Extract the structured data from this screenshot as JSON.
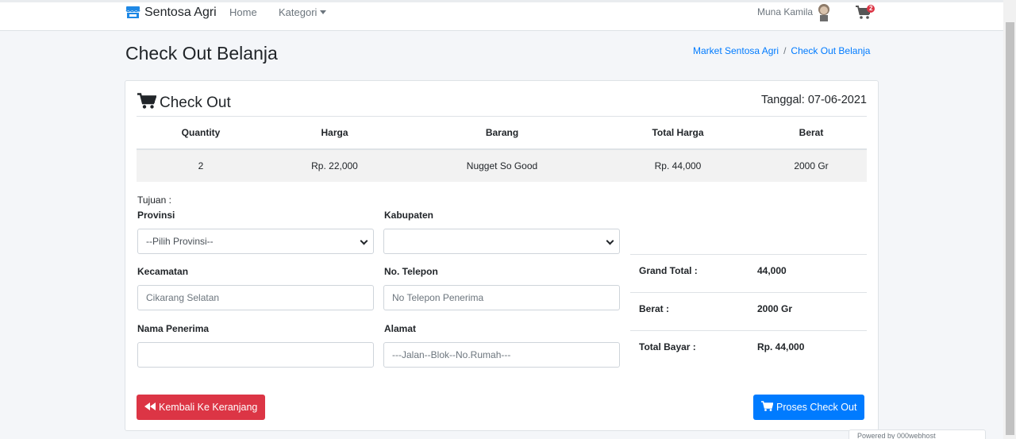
{
  "navbar": {
    "brand": "Sentosa Agri",
    "home": "Home",
    "kategori": "Kategori",
    "user_name": "Muna Kamila",
    "cart_count": "2"
  },
  "page": {
    "title": "Check Out Belanja",
    "breadcrumb": [
      "Market Sentosa Agri",
      "Check Out Belanja"
    ]
  },
  "card": {
    "title": "Check Out",
    "date": "Tanggal: 07-06-2021"
  },
  "table": {
    "headers": [
      "Quantity",
      "Harga",
      "Barang",
      "Total Harga",
      "Berat"
    ],
    "rows": [
      [
        "2",
        "Rp. 22,000",
        "Nugget So Good",
        "Rp. 44,000",
        "2000 Gr"
      ]
    ]
  },
  "form": {
    "tujuan": "Tujuan :",
    "provinsi_label": "Provinsi",
    "provinsi_value": "--Pilih Provinsi--",
    "kabupaten_label": "Kabupaten",
    "kabupaten_value": "",
    "kecamatan_label": "Kecamatan",
    "kecamatan_placeholder": "Cikarang Selatan",
    "telepon_label": "No. Telepon",
    "telepon_placeholder": "No Telepon Penerima",
    "nama_label": "Nama Penerima",
    "nama_placeholder": "",
    "alamat_label": "Alamat",
    "alamat_placeholder": "---Jalan--Blok--No.Rumah---"
  },
  "summary": {
    "grand_total_label": "Grand Total :",
    "grand_total_value": "44,000",
    "berat_label": "Berat :",
    "berat_value": "2000 Gr",
    "total_bayar_label": "Total Bayar :",
    "total_bayar_value": "Rp. 44,000"
  },
  "buttons": {
    "back": "Kembali Ke Keranjang",
    "proses": "Proses Check Out"
  },
  "footer_badge": "Powered by 000webhost",
  "colors": {
    "primary": "#007bff",
    "danger": "#dc3545",
    "background": "#f4f6f9"
  },
  "icons": [
    "store-icon",
    "cart-icon",
    "backward-icon",
    "avatar"
  ]
}
